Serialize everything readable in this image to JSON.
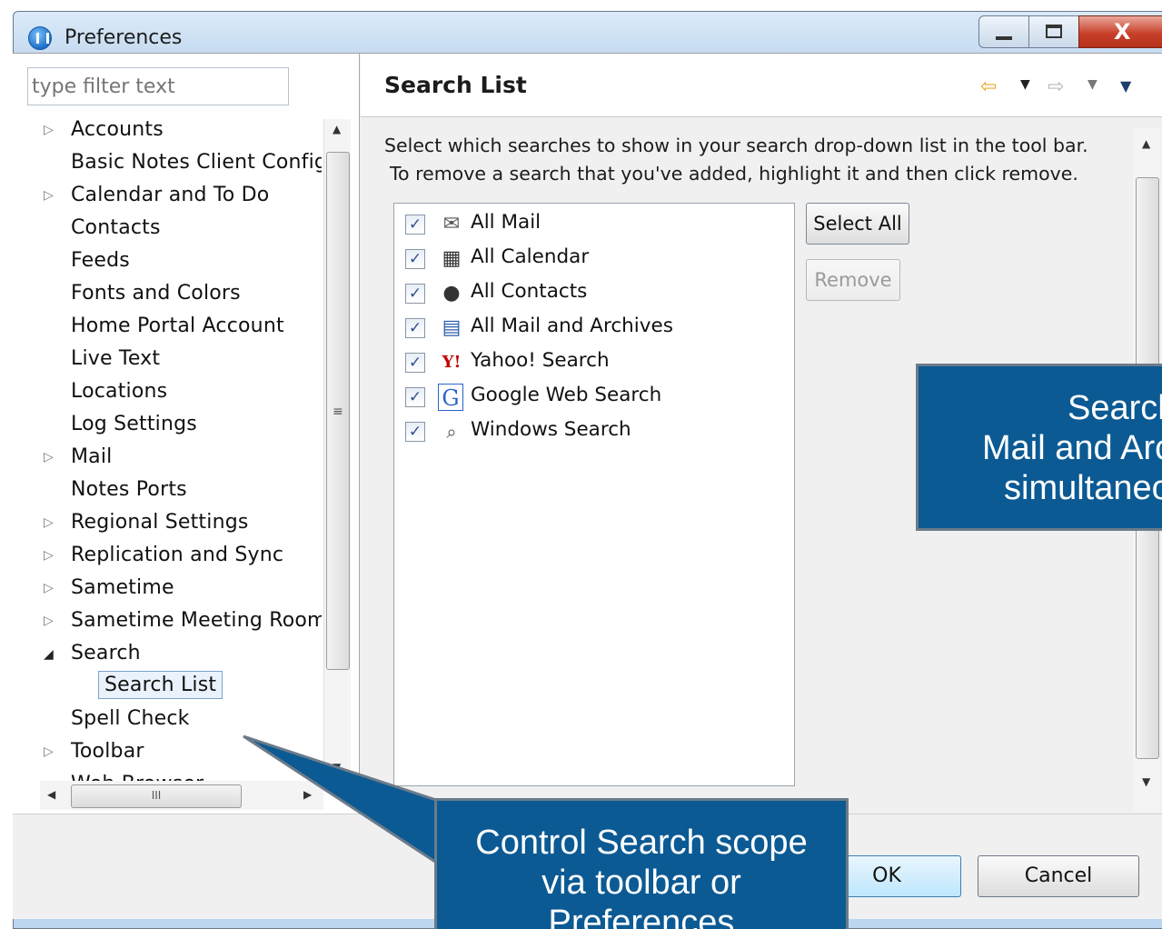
{
  "window": {
    "title": "Preferences",
    "controls": {
      "minimize": "minimize",
      "maximize": "maximize",
      "close": "X"
    }
  },
  "sidebar": {
    "filter_placeholder": "type filter text",
    "items": [
      {
        "label": "Accounts",
        "expandable": true
      },
      {
        "label": "Basic Notes Client Config",
        "expandable": false
      },
      {
        "label": "Calendar and To Do",
        "expandable": true
      },
      {
        "label": "Contacts",
        "expandable": false
      },
      {
        "label": "Feeds",
        "expandable": false
      },
      {
        "label": "Fonts and Colors",
        "expandable": false
      },
      {
        "label": "Home Portal Account",
        "expandable": false
      },
      {
        "label": "Live Text",
        "expandable": false
      },
      {
        "label": "Locations",
        "expandable": false
      },
      {
        "label": "Log Settings",
        "expandable": false
      },
      {
        "label": "Mail",
        "expandable": true
      },
      {
        "label": "Notes Ports",
        "expandable": false
      },
      {
        "label": "Regional Settings",
        "expandable": true
      },
      {
        "label": "Replication and Sync",
        "expandable": true
      },
      {
        "label": "Sametime",
        "expandable": true
      },
      {
        "label": "Sametime Meeting Room",
        "expandable": true
      },
      {
        "label": "Search",
        "expandable": true,
        "expanded": true
      },
      {
        "label": "Search List",
        "child": true,
        "selected": true
      },
      {
        "label": "Spell Check",
        "expandable": false
      },
      {
        "label": "Toolbar",
        "expandable": true
      },
      {
        "label": "Web Browser",
        "expandable": false
      }
    ],
    "hscroll_grip": "III",
    "vscroll_grip": "≡"
  },
  "main": {
    "title": "Search List",
    "description_line1": "Select which searches to show in your search drop-down list in the tool bar.",
    "description_line2": "To remove a search that you've added, highlight it and then click remove.",
    "searches": [
      {
        "label": "All Mail",
        "checked": true,
        "icon": "mail-icon"
      },
      {
        "label": "All Calendar",
        "checked": true,
        "icon": "calendar-icon"
      },
      {
        "label": "All Contacts",
        "checked": true,
        "icon": "contact-icon"
      },
      {
        "label": "All Mail and Archives",
        "checked": true,
        "icon": "archive-icon"
      },
      {
        "label": "Yahoo! Search",
        "checked": true,
        "icon": "yahoo-icon"
      },
      {
        "label": "Google Web Search",
        "checked": true,
        "icon": "google-icon"
      },
      {
        "label": "Windows Search",
        "checked": true,
        "icon": "magnifier-icon"
      }
    ],
    "select_all_label": "Select All",
    "remove_label": "Remove"
  },
  "footer": {
    "ok_label": "OK",
    "cancel_label": "Cancel"
  },
  "callouts": {
    "scope_line1": "Control Search scope",
    "scope_line2": "via toolbar or",
    "scope_line3": "Preferences",
    "mail_line1": "Search",
    "mail_line2": "Mail and Archives",
    "mail_line3": "simultaneously"
  },
  "colors": {
    "callout_bg": "#0b5a94",
    "accent_back_arrow": "#e8a92a"
  }
}
